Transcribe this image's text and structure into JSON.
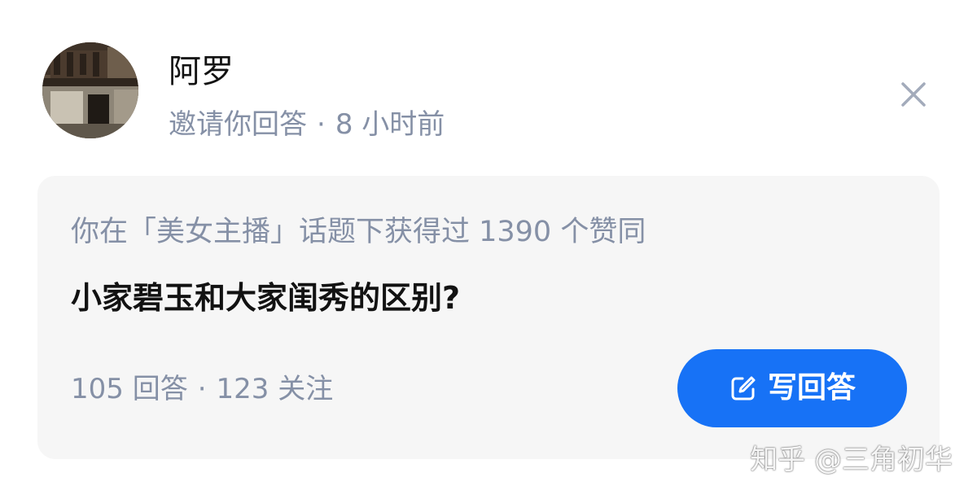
{
  "notification": {
    "user_name": "阿罗",
    "action": "邀请你回答",
    "separator": "·",
    "time_ago": "8 小时前",
    "close_icon": "close-icon",
    "avatar_icon": "avatar"
  },
  "card": {
    "reason": "你在「美女主播」话题下获得过 1390 个赞同",
    "question_title": "小家碧玉和大家闺秀的区别?",
    "answers": "105 回答",
    "separator": "·",
    "followers": "123 关注",
    "write_button_label": "写回答",
    "write_button_icon": "edit-icon",
    "accent_color": "#1772f6"
  },
  "watermark": {
    "text": "知乎 @三角初华"
  }
}
